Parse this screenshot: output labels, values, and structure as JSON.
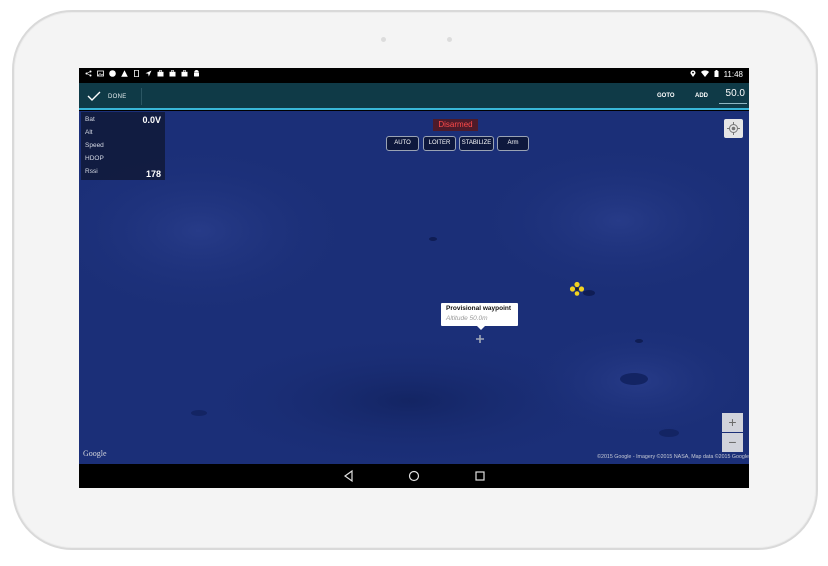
{
  "status_bar": {
    "time": "11:48"
  },
  "action_bar": {
    "done_label": "DONE",
    "goto_label": "GOTO",
    "add_label": "ADD",
    "altitude_value": "50.0"
  },
  "telemetry": {
    "rows": [
      {
        "label": "Bat",
        "value": "0.0V"
      },
      {
        "label": "Alt",
        "value": ""
      },
      {
        "label": "Speed",
        "value": ""
      },
      {
        "label": "HDOP",
        "value": ""
      },
      {
        "label": "Rssi",
        "value": "178"
      }
    ]
  },
  "map": {
    "arm_status": "Disarmed",
    "mode_buttons": [
      "AUTO",
      "LOITER",
      "STABILIZE",
      "Arm"
    ],
    "waypoint_title": "Provisional waypoint",
    "waypoint_subtitle": "Altitude 50.0m",
    "google_logo": "Google",
    "copyright": "©2015 Google - Imagery ©2015 NASA, Map data ©2015 Google",
    "zoom_in": "+",
    "zoom_out": "−"
  },
  "icons": {
    "done": "check-icon",
    "locate": "my-location-icon",
    "vehicle": "drone-icon",
    "waypoint": "crosshair-icon",
    "nav_back": "back-triangle-icon",
    "nav_home": "home-circle-icon",
    "nav_recent": "recent-square-icon"
  },
  "colors": {
    "action_bar": "#0f3a47",
    "accent": "#39b7d8",
    "map_water": "#1b2f78",
    "disarmed_text": "#ff4a4a",
    "drone": "#f2d320"
  }
}
